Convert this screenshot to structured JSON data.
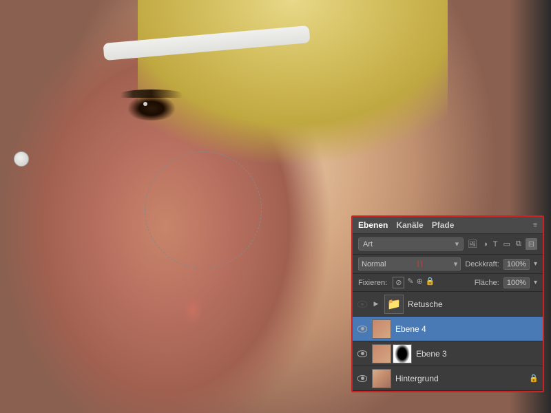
{
  "canvas": {
    "circle_selection": true
  },
  "panel": {
    "title": "Layers Panel",
    "tabs": [
      {
        "id": "ebenen",
        "label": "Ebenen",
        "active": true
      },
      {
        "id": "kanaele",
        "label": "Kanäle",
        "active": false
      },
      {
        "id": "pfade",
        "label": "Pfade",
        "active": false
      }
    ],
    "search_placeholder": "Art",
    "blend_mode": "Normal",
    "opacity_label": "Deckkraft:",
    "opacity_value": "100%",
    "fill_label": "Fläche:",
    "fill_value": "100%",
    "lock_label": "Fixieren:",
    "layers": [
      {
        "id": "retusche",
        "name": "Retusche",
        "type": "folder",
        "visible": false,
        "active": false
      },
      {
        "id": "ebene4",
        "name": "Ebene 4",
        "type": "layer",
        "visible": true,
        "active": true
      },
      {
        "id": "ebene3",
        "name": "Ebene 3",
        "type": "layer-mask",
        "visible": true,
        "active": false
      },
      {
        "id": "hintergrund",
        "name": "Hintergrund",
        "type": "background",
        "visible": true,
        "active": false,
        "locked": true
      }
    ]
  }
}
